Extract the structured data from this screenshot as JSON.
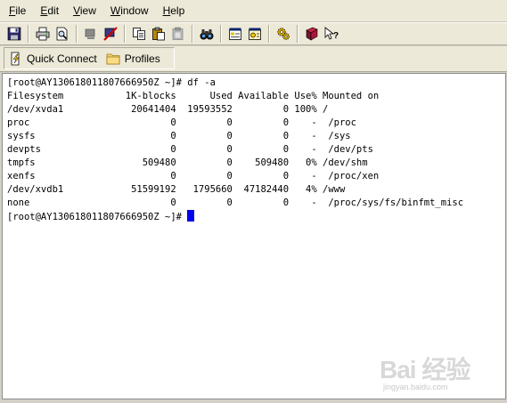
{
  "menu": {
    "items": [
      {
        "mnemonic": "F",
        "rest": "ile"
      },
      {
        "mnemonic": "E",
        "rest": "dit"
      },
      {
        "mnemonic": "V",
        "rest": "iew"
      },
      {
        "mnemonic": "W",
        "rest": "indow"
      },
      {
        "mnemonic": "H",
        "rest": "elp"
      }
    ]
  },
  "toolbar": {
    "icons": [
      "save-icon",
      "print-icon",
      "print-preview-icon",
      "disconnect-icon",
      "disconnect-red-icon",
      "copy-icon",
      "paste-icon",
      "paste-disabled-icon",
      "find-icon",
      "properties-icon",
      "settings-icon",
      "gears-icon",
      "help-book-icon",
      "context-help-icon"
    ]
  },
  "linkbar": {
    "quick_connect": "Quick Connect",
    "profiles": "Profiles"
  },
  "terminal": {
    "lines": [
      "[root@AY130618011807666950Z ~]# df -a",
      "Filesystem           1K-blocks      Used Available Use% Mounted on",
      "/dev/xvda1            20641404  19593552         0 100% /",
      "proc                         0         0         0    -  /proc",
      "sysfs                        0         0         0    -  /sys",
      "devpts                       0         0         0    -  /dev/pts",
      "tmpfs                   509480         0    509480   0% /dev/shm",
      "xenfs                        0         0         0    -  /proc/xen",
      "/dev/xvdb1            51599192   1795660  47182440   4% /www",
      "none                         0         0         0    -  /proc/sys/fs/binfmt_misc"
    ],
    "prompt": "[root@AY130618011807666950Z ~]# "
  },
  "watermark": {
    "main": "Bai 经验",
    "sub": "jingyan.baidu.com"
  },
  "colors": {
    "cursor": "#0000ee",
    "chrome": "#ece9d8",
    "terminal_bg": "#ffffff"
  }
}
